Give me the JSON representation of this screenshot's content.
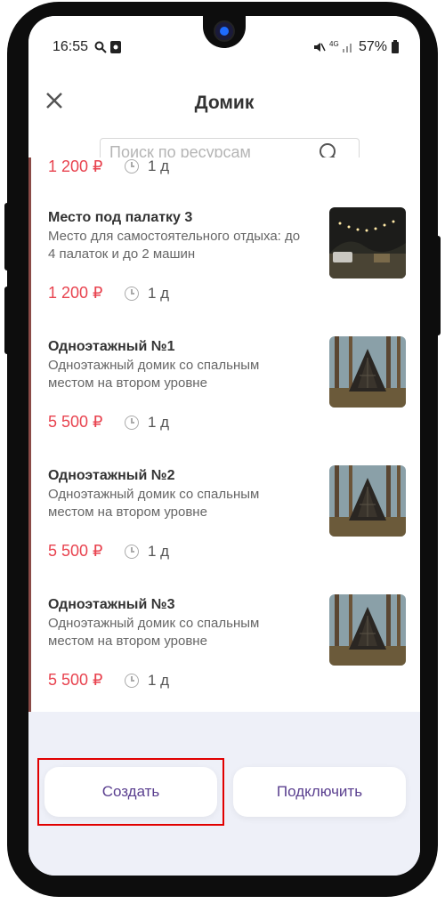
{
  "status_bar": {
    "time": "16:55",
    "battery": "57%",
    "network": "4G"
  },
  "header": {
    "title": "Домик",
    "close_icon": "close-icon"
  },
  "search": {
    "placeholder": "Поиск по ресурсам",
    "value": ""
  },
  "resources": [
    {
      "name": "",
      "description": "",
      "price": "1 200 ₽",
      "duration": "1 д"
    },
    {
      "name": "Место под палатку 3",
      "description": "Место для самостоятельного отдыха: до 4 палаток и до 2 машин",
      "price": "1 200 ₽",
      "duration": "1 д"
    },
    {
      "name": "Одноэтажный №1",
      "description": "Одноэтажный домик со спальным местом на втором уровне",
      "price": "5 500 ₽",
      "duration": "1 д"
    },
    {
      "name": "Одноэтажный №2",
      "description": "Одноэтажный домик со спальным местом на втором уровне",
      "price": "5 500 ₽",
      "duration": "1 д"
    },
    {
      "name": "Одноэтажный №3",
      "description": "Одноэтажный домик со спальным местом на втором уровне",
      "price": "5 500 ₽",
      "duration": "1 д"
    }
  ],
  "actions": {
    "create_label": "Создать",
    "connect_label": "Подключить"
  },
  "colors": {
    "price": "#e8434f",
    "accent": "#5a3f8f",
    "highlight": "#e10000"
  }
}
